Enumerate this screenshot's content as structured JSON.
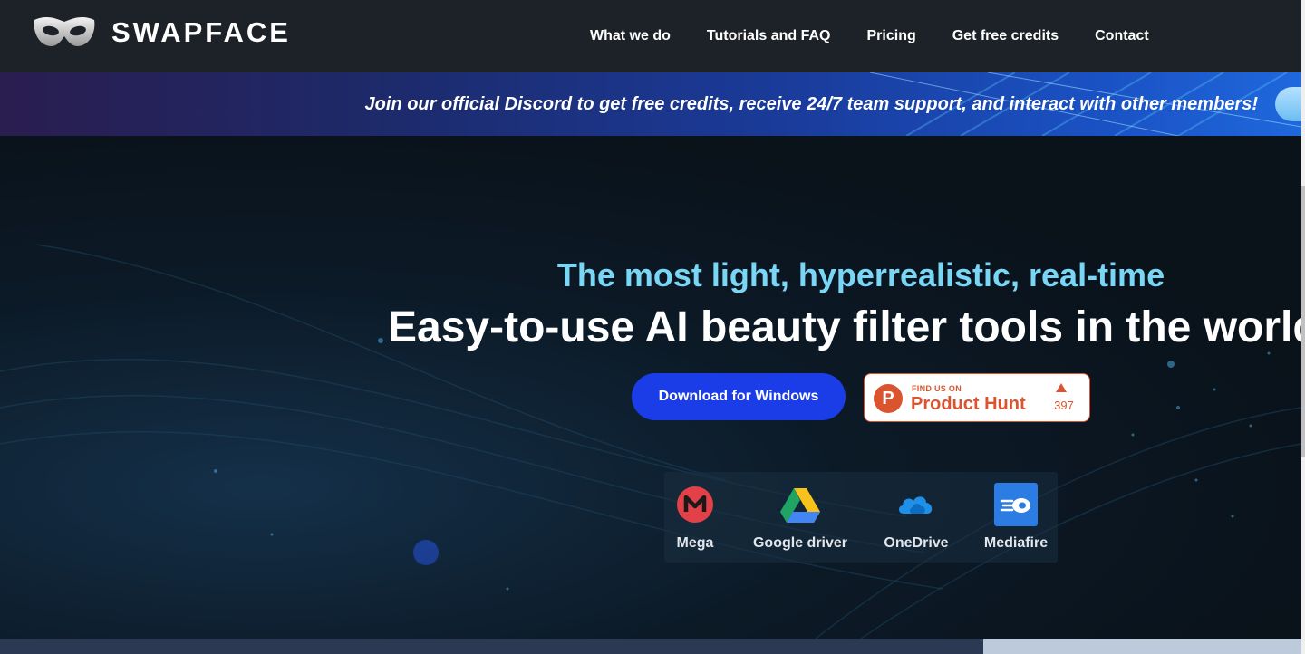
{
  "header": {
    "brand": "SWAPFACE",
    "logo_icon": "mask-icon",
    "nav": [
      "What we do",
      "Tutorials and FAQ",
      "Pricing",
      "Get free credits",
      "Contact"
    ]
  },
  "banner": {
    "text": "Join our official Discord to get free credits, receive 24/7 team support, and interact with other members!"
  },
  "hero": {
    "subtitle": "The most light, hyperrealistic, real-time",
    "headline": "Easy-to-use AI beauty filter tools in the world",
    "download_button": "Download for Windows",
    "product_hunt": {
      "small_label": "FIND US ON",
      "name": "Product Hunt",
      "upvotes": "397"
    },
    "downloads": [
      {
        "label": "Mega",
        "icon": "mega-icon"
      },
      {
        "label": "Google driver",
        "icon": "google-drive-icon"
      },
      {
        "label": "OneDrive",
        "icon": "onedrive-icon"
      },
      {
        "label": "Mediafire",
        "icon": "mediafire-icon"
      }
    ]
  },
  "colors": {
    "header_bg": "#1d2229",
    "accent_blue": "#1a3de8",
    "subtitle_cyan": "#7ad6f5",
    "product_hunt": "#da552f"
  }
}
